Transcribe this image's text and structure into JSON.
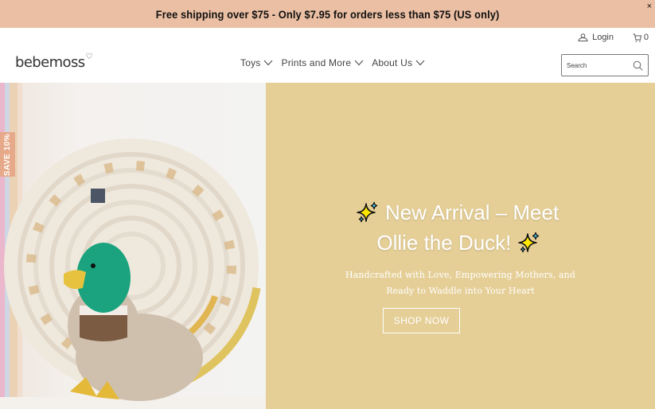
{
  "announcement": {
    "text": "Free shipping over $75 - Only $7.95 for orders less than $75 (US only)",
    "close_label": "×"
  },
  "header": {
    "login_label": "Login",
    "cart_count": "0",
    "logo_text": "bebemoss",
    "logo_heart": "♡",
    "nav": [
      {
        "label": "Toys",
        "icon": "chevron-down-icon"
      },
      {
        "label": "Prints and More",
        "icon": "chevron-down-icon"
      },
      {
        "label": "About Us",
        "icon": "chevron-down-icon"
      }
    ],
    "search_placeholder": "Search"
  },
  "hero": {
    "save_tab": "SAVE 10%",
    "title_line1": "New Arrival – Meet",
    "title_line2": "Ollie the Duck!",
    "subtitle_line1": "Handcrafted with Love, Empowering Mothers, and",
    "subtitle_line2": "Ready to Waddle into Your Heart",
    "button_label": "SHOP NOW",
    "panel_color": "#e5cf97"
  },
  "colors": {
    "announcement_bg": "#ebbfa3",
    "save_tab_bg": "#e6a989"
  }
}
